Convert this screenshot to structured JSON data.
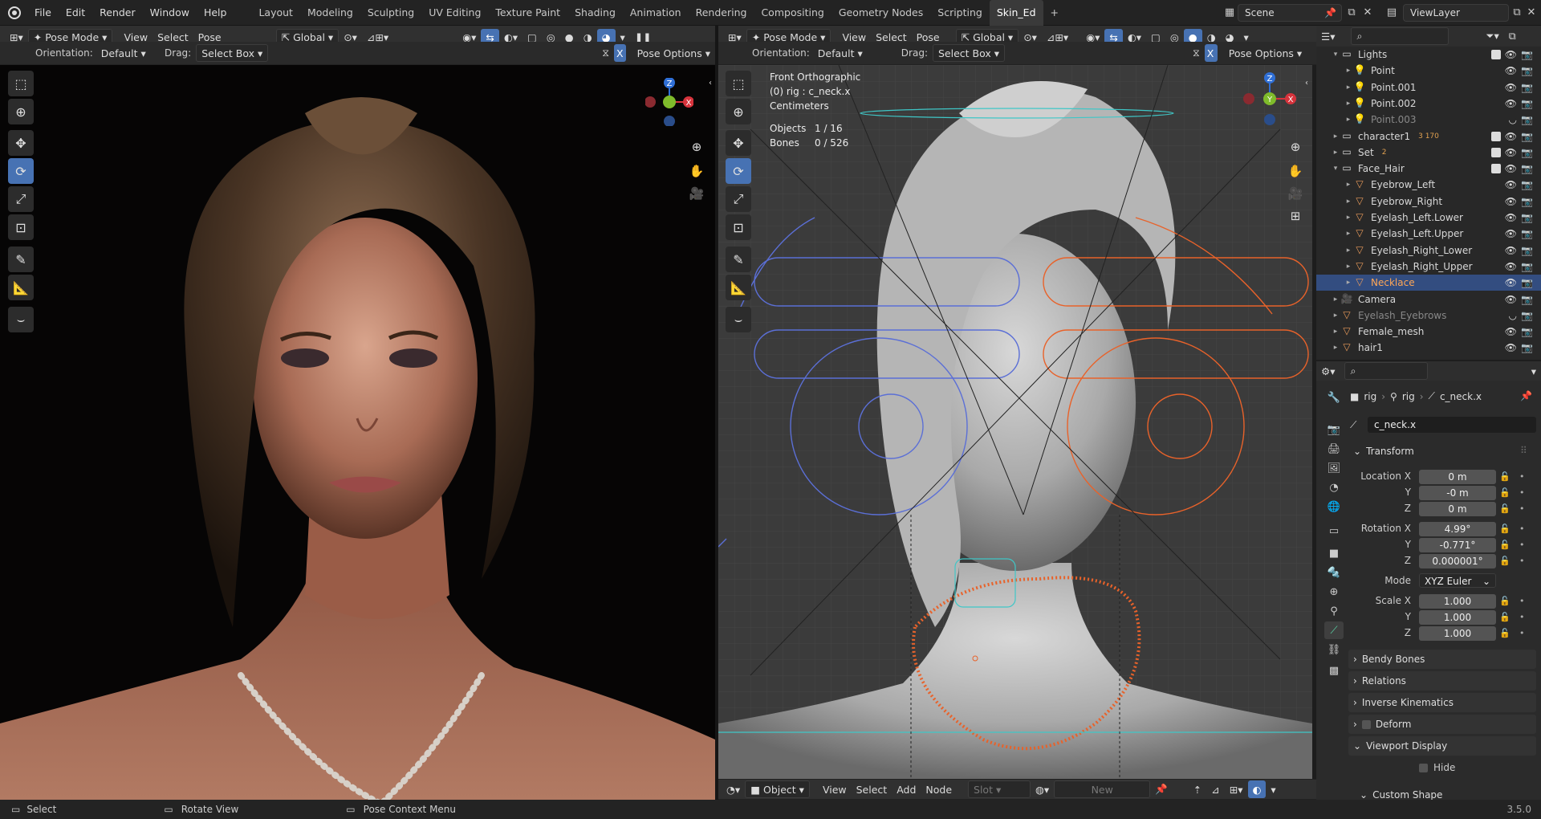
{
  "topbar": {
    "menus": [
      "File",
      "Edit",
      "Render",
      "Window",
      "Help"
    ],
    "workspaces": [
      "Layout",
      "Modeling",
      "Sculpting",
      "UV Editing",
      "Texture Paint",
      "Shading",
      "Animation",
      "Rendering",
      "Compositing",
      "Geometry Nodes",
      "Scripting",
      "Skin_Ed"
    ],
    "active_workspace": "Skin_Ed",
    "add_tab": "+",
    "scene": "Scene",
    "view_layer": "ViewLayer"
  },
  "left_viewport": {
    "mode": "Pose Mode",
    "menus": [
      "View",
      "Select",
      "Pose"
    ],
    "transform": "Global",
    "orientation_label": "Orientation:",
    "orientation_value": "Default",
    "drag_label": "Drag:",
    "drag_value": "Select Box",
    "x_badge": "X",
    "pose_options": "Pose Options",
    "axes": {
      "z": "Z",
      "y": "Y",
      "x": "X"
    }
  },
  "right_viewport": {
    "mode": "Pose Mode",
    "menus": [
      "View",
      "Select",
      "Pose"
    ],
    "transform": "Global",
    "orientation_label": "Orientation:",
    "orientation_value": "Default",
    "drag_label": "Drag:",
    "drag_value": "Select Box",
    "x_badge": "X",
    "pose_options": "Pose Options",
    "overlay": {
      "view_name": "Front Orthographic",
      "active": "(0) rig : c_neck.x",
      "units": "Centimeters",
      "objects_label": "Objects",
      "objects_value": "1 / 16",
      "bones_label": "Bones",
      "bones_value": "0 / 526"
    },
    "axes": {
      "z": "Z",
      "y": "Y",
      "x": "X"
    }
  },
  "node_editor_header": {
    "object": "Object",
    "menus": [
      "View",
      "Select",
      "Add",
      "Node"
    ],
    "slot": "Slot",
    "new": "New"
  },
  "outliner": {
    "rows": [
      {
        "name": "Lights",
        "indent": 1,
        "icon": "collection-icon",
        "expanded": true,
        "dim": false,
        "selected": false
      },
      {
        "name": "Point",
        "indent": 2,
        "icon": "light-icon",
        "dim": false,
        "selected": false
      },
      {
        "name": "Point.001",
        "indent": 2,
        "icon": "light-icon",
        "dim": false,
        "selected": false
      },
      {
        "name": "Point.002",
        "indent": 2,
        "icon": "light-icon",
        "dim": false,
        "selected": false
      },
      {
        "name": "Point.003",
        "indent": 2,
        "icon": "light-icon",
        "dim": true,
        "selected": false
      },
      {
        "name": "character1",
        "indent": 1,
        "icon": "collection-icon",
        "dim": false,
        "selected": false,
        "badge": "3 170"
      },
      {
        "name": "Set",
        "indent": 1,
        "icon": "collection-icon",
        "dim": false,
        "selected": false,
        "badge": "2"
      },
      {
        "name": "Face_Hair",
        "indent": 1,
        "icon": "collection-icon",
        "expanded": true,
        "dim": false,
        "selected": false
      },
      {
        "name": "Eyebrow_Left",
        "indent": 2,
        "icon": "mesh-icon",
        "dim": false,
        "selected": false
      },
      {
        "name": "Eyebrow_Right",
        "indent": 2,
        "icon": "mesh-icon",
        "dim": false,
        "selected": false
      },
      {
        "name": "Eyelash_Left.Lower",
        "indent": 2,
        "icon": "mesh-icon",
        "dim": false,
        "selected": false
      },
      {
        "name": "Eyelash_Left.Upper",
        "indent": 2,
        "icon": "mesh-icon",
        "dim": false,
        "selected": false
      },
      {
        "name": "Eyelash_Right_Lower",
        "indent": 2,
        "icon": "mesh-icon",
        "dim": false,
        "selected": false
      },
      {
        "name": "Eyelash_Right_Upper",
        "indent": 2,
        "icon": "mesh-icon",
        "dim": false,
        "selected": false
      },
      {
        "name": "Necklace",
        "indent": 2,
        "icon": "mesh-icon",
        "dim": false,
        "selected": true
      },
      {
        "name": "Camera",
        "indent": 1,
        "icon": "camera-icon",
        "dim": false,
        "selected": false
      },
      {
        "name": "Eyelash_Eyebrows",
        "indent": 1,
        "icon": "mesh-icon",
        "dim": true,
        "selected": false
      },
      {
        "name": "Female_mesh",
        "indent": 1,
        "icon": "mesh-icon",
        "dim": false,
        "selected": false
      },
      {
        "name": "hair1",
        "indent": 1,
        "icon": "mesh-icon",
        "dim": false,
        "selected": false
      }
    ]
  },
  "properties": {
    "breadcrumb": [
      "rig",
      "rig",
      "c_neck.x"
    ],
    "bone_name": "c_neck.x",
    "transform_title": "Transform",
    "location": {
      "label_x": "Location X",
      "label_y": "Y",
      "label_z": "Z",
      "x": "0 m",
      "y": "-0 m",
      "z": "0 m"
    },
    "rotation": {
      "label_x": "Rotation X",
      "label_y": "Y",
      "label_z": "Z",
      "x": "4.99°",
      "y": "-0.771°",
      "z": "0.000001°"
    },
    "mode_label": "Mode",
    "mode_value": "XYZ Euler",
    "scale": {
      "label_x": "Scale X",
      "label_y": "Y",
      "label_z": "Z",
      "x": "1.000",
      "y": "1.000",
      "z": "1.000"
    },
    "panels": [
      "Bendy Bones",
      "Relations",
      "Inverse Kinematics",
      "Deform",
      "Viewport Display"
    ],
    "hide_label": "Hide",
    "custom_shape": "Custom Shape"
  },
  "status": {
    "select": "Select",
    "rotate": "Rotate View",
    "context": "Pose Context Menu",
    "version": "3.5.0"
  },
  "colors": {
    "accent": "#4772b3",
    "selection": "#334d80",
    "bone_orange": "#e8622a",
    "bone_blue": "#5b6fd6",
    "bone_cyan": "#3fc7c7"
  }
}
